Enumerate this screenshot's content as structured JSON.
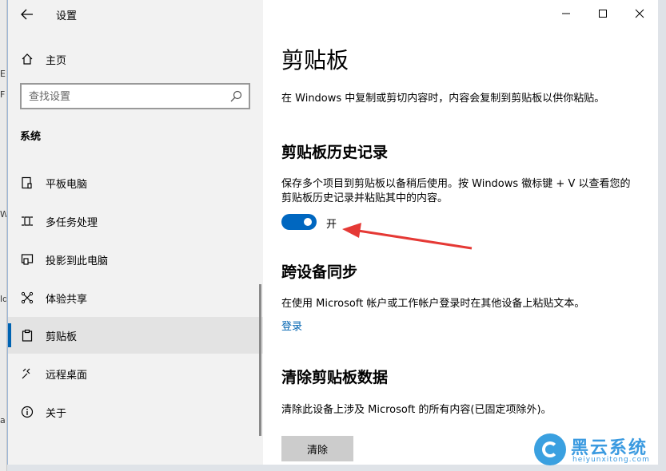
{
  "background_window": {
    "fragments": [
      "E",
      "F",
      "W",
      "ld",
      "a"
    ]
  },
  "window": {
    "title": "设置",
    "caption_buttons": [
      "minimize",
      "maximize",
      "close"
    ]
  },
  "sidebar": {
    "home_label": "主页",
    "search": {
      "placeholder": "查找设置",
      "value": ""
    },
    "section_label": "系统",
    "items": [
      {
        "label": "平板电脑",
        "icon": "tablet-icon"
      },
      {
        "label": "多任务处理",
        "icon": "multitask-icon"
      },
      {
        "label": "投影到此电脑",
        "icon": "project-icon"
      },
      {
        "label": "体验共享",
        "icon": "share-icon"
      },
      {
        "label": "剪贴板",
        "icon": "clipboard-icon",
        "active": true
      },
      {
        "label": "远程桌面",
        "icon": "remote-desktop-icon"
      },
      {
        "label": "关于",
        "icon": "info-icon"
      }
    ]
  },
  "content": {
    "title": "剪贴板",
    "intro": "在 Windows 中复制或剪切内容时，内容会复制到剪贴板以供你粘贴。",
    "history": {
      "heading": "剪贴板历史记录",
      "description": "保存多个项目到剪贴板以备稍后使用。按 Windows 徽标键 + V 以查看您的剪贴板历史记录并粘贴其中的内容。",
      "toggle_state": "开",
      "toggle_on": true
    },
    "sync": {
      "heading": "跨设备同步",
      "description": "在使用 Microsoft 帐户或工作帐户登录时在其他设备上粘贴文本。",
      "link": "登录"
    },
    "clear": {
      "heading": "清除剪贴板数据",
      "description": "清除此设备上涉及 Microsoft 的所有内容(已固定项除外)。",
      "button": "清除"
    }
  },
  "watermark": {
    "cn": "黑云系统",
    "en": "heiyunxitong.com"
  },
  "colors": {
    "accent": "#0067c0",
    "arrow": "#e53935",
    "link": "#0063b1"
  }
}
